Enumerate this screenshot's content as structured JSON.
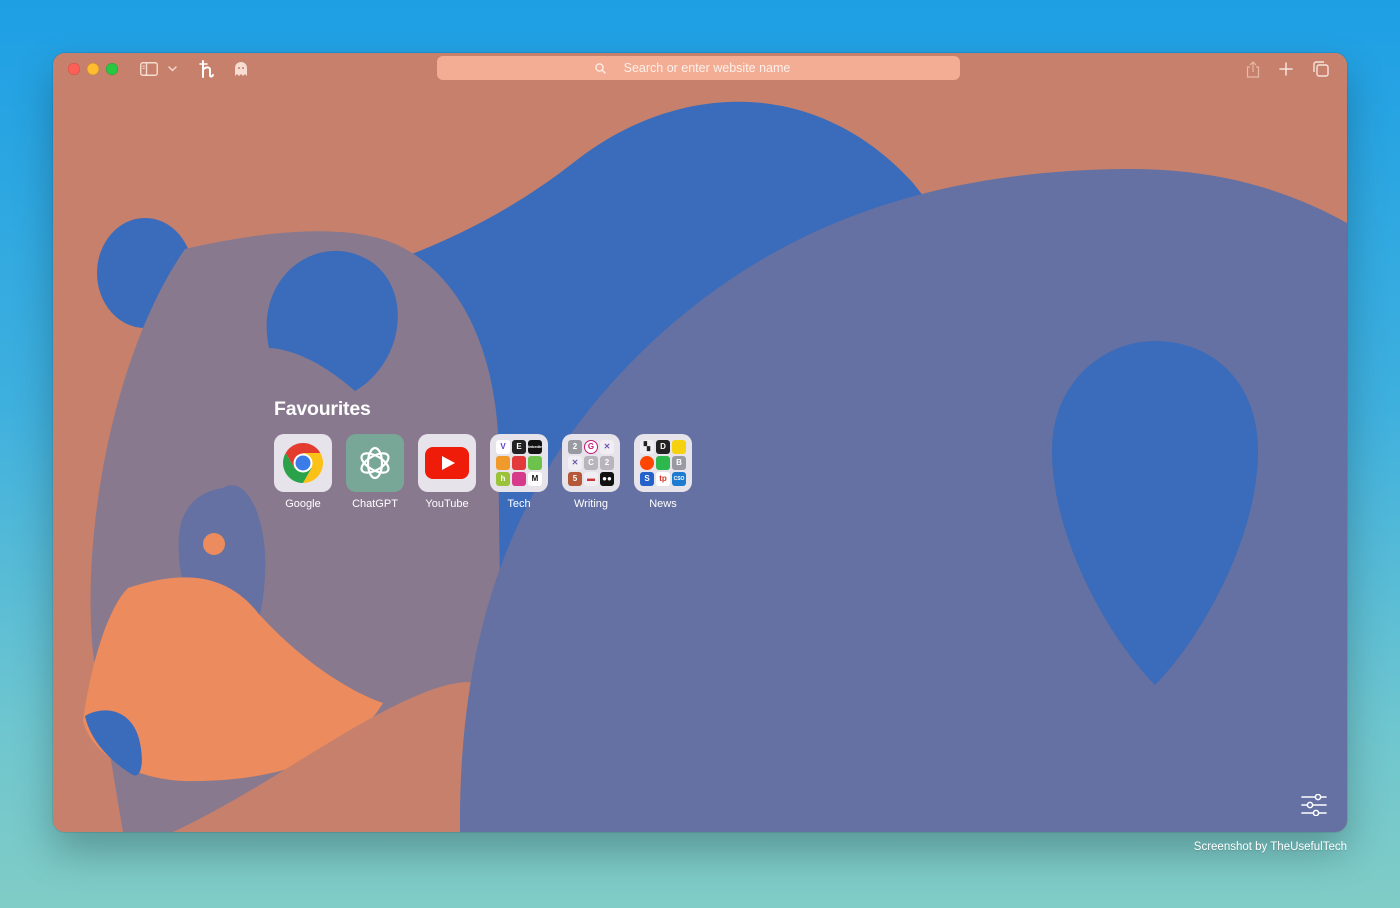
{
  "window": {
    "controls": [
      "close",
      "minimize",
      "zoom"
    ],
    "toolbar_icons_left": [
      "sidebar-icon",
      "chevron-down-icon",
      "extension-h-icon",
      "ghost-icon"
    ],
    "toolbar_icons_right": [
      "share-icon",
      "plus-icon",
      "tabs-overview-icon"
    ]
  },
  "search": {
    "placeholder": "Search or enter website name",
    "value": ""
  },
  "favourites": {
    "title": "Favourites",
    "items": [
      {
        "label": "Google",
        "icon": "chrome-icon"
      },
      {
        "label": "ChatGPT",
        "icon": "openai-icon"
      },
      {
        "label": "YouTube",
        "icon": "youtube-icon"
      },
      {
        "label": "Tech",
        "icon": "folder-icon",
        "mini": [
          "V",
          "E",
          "linkedin",
          "",
          "",
          "",
          "h",
          "",
          "M"
        ]
      },
      {
        "label": "Writing",
        "icon": "folder-icon",
        "mini": [
          "2",
          "G",
          "",
          "",
          "C",
          "2",
          "5",
          "",
          ""
        ]
      },
      {
        "label": "News",
        "icon": "folder-icon",
        "mini": [
          "",
          "D",
          "",
          "",
          "",
          "B",
          "S",
          "tp",
          "CSO"
        ]
      }
    ]
  },
  "credit": "Screenshot by TheUsefulTech",
  "colors": {
    "wallpaper_base": "#c6806b",
    "blue": "#3a6cbb",
    "slate": "#6471a2",
    "mauve": "#88798f",
    "orange": "#ec8b5e",
    "address_bar": "#f3ad95"
  }
}
